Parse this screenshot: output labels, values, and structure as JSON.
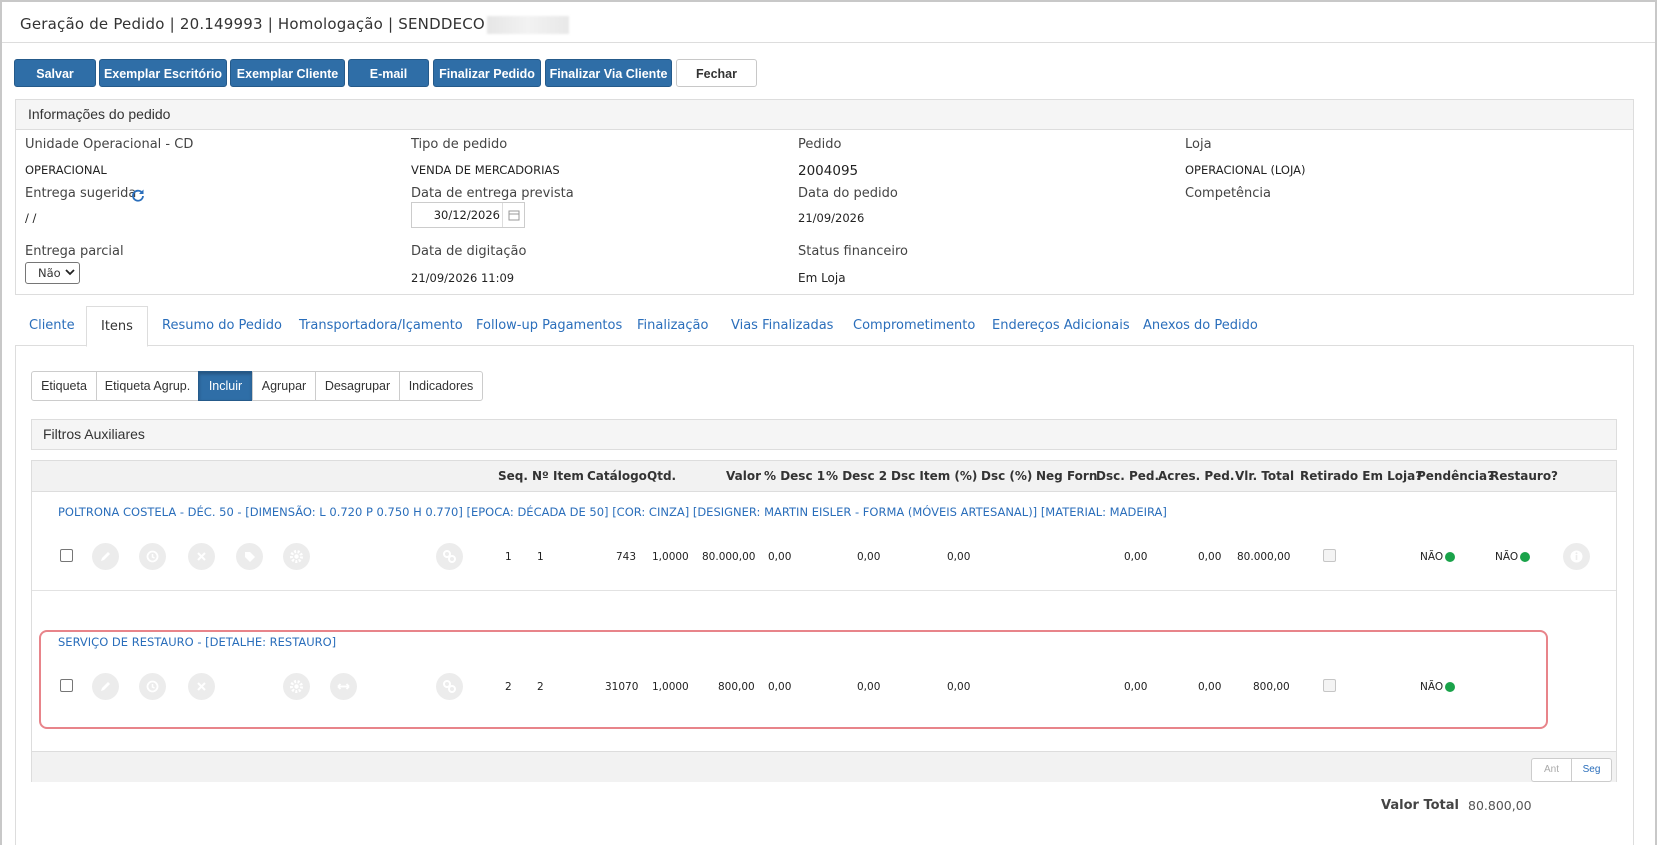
{
  "window": {
    "title": "Geração de Pedido | 20.149993 | Homologação | SENDDECO"
  },
  "toolbar": {
    "buttons": [
      {
        "label": "Salvar",
        "style": "primary"
      },
      {
        "label": "Exemplar Escritório",
        "style": "primary"
      },
      {
        "label": "Exemplar Cliente",
        "style": "primary"
      },
      {
        "label": "E-mail",
        "style": "primary"
      },
      {
        "label": "Finalizar Pedido",
        "style": "primary"
      },
      {
        "label": "Finalizar Via Cliente",
        "style": "primary"
      },
      {
        "label": "Fechar",
        "style": "default"
      }
    ]
  },
  "order_info": {
    "title": "Informações do pedido",
    "unidade_label": "Unidade Operacional - CD",
    "unidade_value": "OPERACIONAL",
    "tipo_label": "Tipo de pedido",
    "tipo_value": "VENDA DE MERCADORIAS",
    "pedido_label": "Pedido",
    "pedido_value": "2004095",
    "loja_label": "Loja",
    "loja_value": "OPERACIONAL (LOJA)",
    "entrega_sugerida_label": "Entrega sugerida",
    "entrega_sugerida_value": "/ /",
    "data_entrega_label": "Data de entrega prevista",
    "data_entrega_value": "30/12/2026",
    "data_pedido_label": "Data do pedido",
    "data_pedido_value": "21/09/2026",
    "competencia_label": "Competência",
    "entrega_parcial_label": "Entrega parcial",
    "entrega_parcial_value": "Não",
    "data_digitacao_label": "Data de digitação",
    "data_digitacao_value": "21/09/2026 11:09",
    "status_fin_label": "Status financeiro",
    "status_fin_value": "Em Loja"
  },
  "tabs": [
    {
      "label": "Cliente",
      "active": false
    },
    {
      "label": "Itens",
      "active": true
    },
    {
      "label": "Resumo do Pedido",
      "active": false
    },
    {
      "label": "Transportadora/Içamento",
      "active": false
    },
    {
      "label": "Follow-up Pagamentos",
      "active": false
    },
    {
      "label": "Finalização",
      "active": false
    },
    {
      "label": "Vias Finalizadas",
      "active": false
    },
    {
      "label": "Comprometimento",
      "active": false
    },
    {
      "label": "Endereços Adicionais",
      "active": false
    },
    {
      "label": "Anexos do Pedido",
      "active": false
    }
  ],
  "subtoolbar": [
    {
      "label": "Etiqueta",
      "active": false
    },
    {
      "label": "Etiqueta Agrup.",
      "active": false
    },
    {
      "label": "Incluir",
      "active": true
    },
    {
      "label": "Agrupar",
      "active": false
    },
    {
      "label": "Desagrupar",
      "active": false
    },
    {
      "label": "Indicadores",
      "active": false
    }
  ],
  "filters": {
    "title": "Filtros Auxiliares"
  },
  "grid": {
    "columns": [
      "Seq.",
      "Nº Item",
      "Catálogo",
      "Qtd.",
      "Valor",
      "% Desc 1",
      "% Desc 2",
      "Dsc Item (%)",
      "Dsc (%)",
      "Neg Forn",
      "Dsc. Ped.",
      "Acres. Ped.",
      "Vlr. Total",
      "Retirado Em Loja?",
      "Pendência?",
      "Restauro?"
    ],
    "rows": [
      {
        "title": "POLTRONA COSTELA - DÉC. 50 - [DIMENSÃO: L 0.720 P 0.750 H 0.770] [EPOCA: DÉCADA DE 50] [COR: CINZA] [DESIGNER: MARTIN EISLER - FORMA (MÓVEIS ARTESANAL)] [MATERIAL: MADEIRA]",
        "seq": "1",
        "item": "1",
        "catalogo": "743",
        "qtd": "1,0000",
        "valor": "80.000,00",
        "desc1": "0,00",
        "desc2": "0,00",
        "dsc_item": "0,00",
        "dsc_ped": "0,00",
        "acres_ped": "0,00",
        "vlr_total": "80.000,00",
        "pendencia": "NÃO",
        "restauro": "NÃO"
      },
      {
        "title": "SERVIÇO DE RESTAURO - [DETALHE: RESTAURO]",
        "seq": "2",
        "item": "2",
        "catalogo": "31070",
        "qtd": "1,0000",
        "valor": "800,00",
        "desc1": "0,00",
        "desc2": "0,00",
        "dsc_item": "0,00",
        "dsc_ped": "0,00",
        "acres_ped": "0,00",
        "vlr_total": "800,00",
        "pendencia": "NÃO"
      }
    ],
    "pager": {
      "prev": "Ant",
      "next": "Seg"
    }
  },
  "totals": {
    "label": "Valor Total",
    "value": "80.800,00"
  },
  "colors": {
    "primary": "#2f6ea7",
    "link": "#2a6ebb",
    "status_green": "#1aa34a",
    "highlight": "#e8848a"
  },
  "icons": [
    "refresh-icon",
    "calendar-icon",
    "edit-icon",
    "history-icon",
    "close-icon",
    "tag-icon",
    "gear-icon",
    "expand-icon",
    "link-icon",
    "info-icon"
  ]
}
